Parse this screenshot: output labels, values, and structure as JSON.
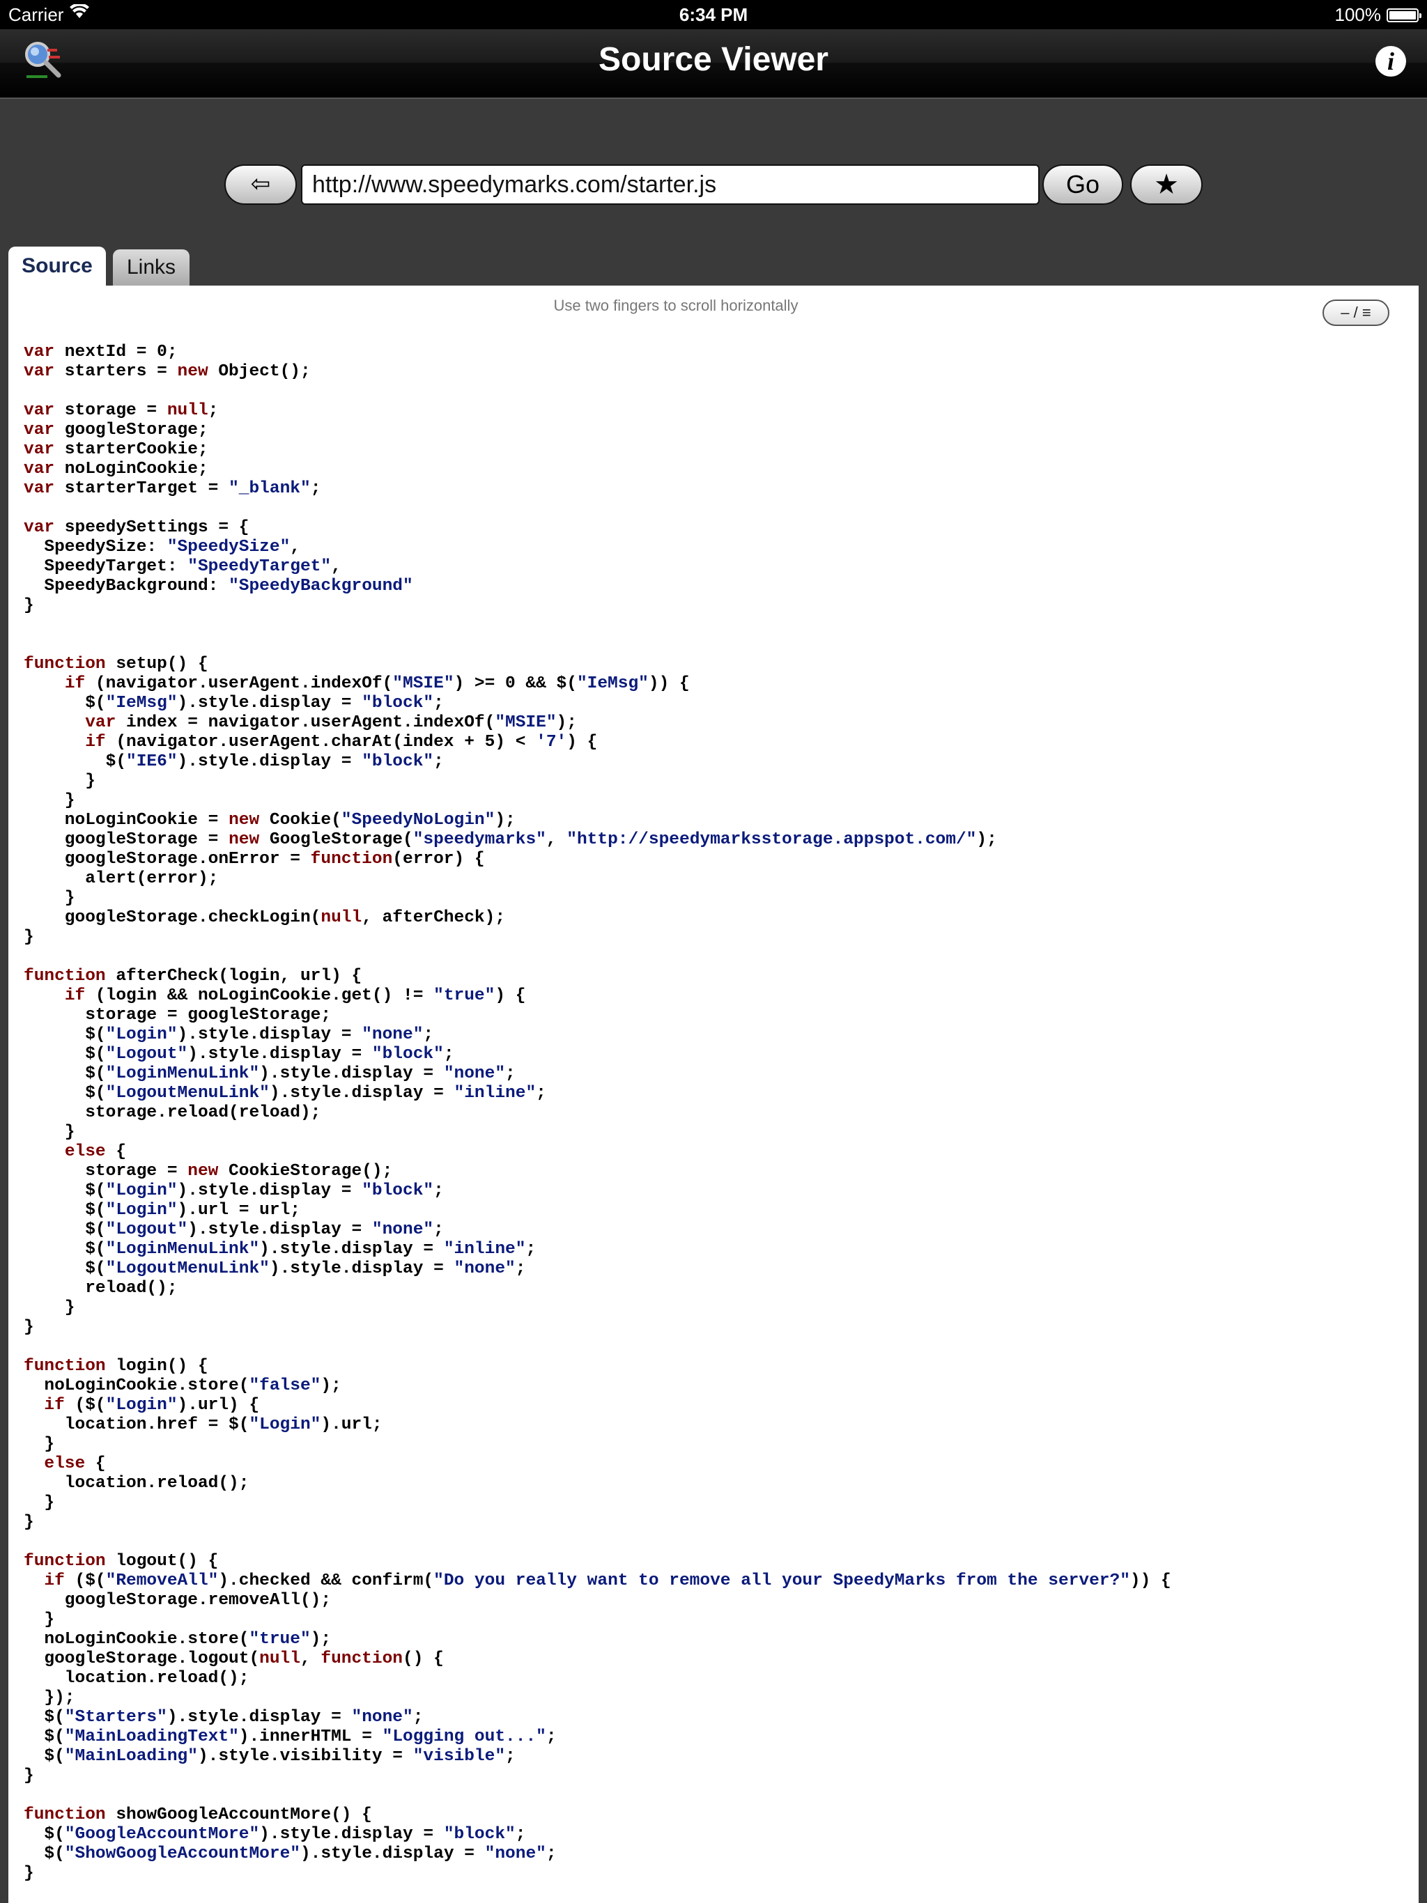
{
  "status_bar": {
    "carrier": "Carrier",
    "time": "6:34 PM",
    "battery": "100%"
  },
  "navbar": {
    "title": "Source Viewer",
    "info_label": "i"
  },
  "toolbar": {
    "back_label": "⇦",
    "url": "http://www.speedymarks.com/starter.js",
    "go_label": "Go",
    "favorite_label": "★"
  },
  "tabs": [
    {
      "label": "Source",
      "active": true
    },
    {
      "label": "Links",
      "active": false
    }
  ],
  "content": {
    "hint": "Use two fingers to scroll horizontally",
    "toggle_label": "– / ≡"
  },
  "code_lines": [
    "var nextId = 0;",
    "var starters = new Object();",
    "",
    "var storage = null;",
    "var googleStorage;",
    "var starterCookie;",
    "var noLoginCookie;",
    "var starterTarget = \"_blank\";",
    "",
    "var speedySettings = {",
    "  SpeedySize: \"SpeedySize\",",
    "  SpeedyTarget: \"SpeedyTarget\",",
    "  SpeedyBackground: \"SpeedyBackground\"",
    "}",
    "",
    "",
    "function setup() {",
    "    if (navigator.userAgent.indexOf(\"MSIE\") >= 0 && $(\"IeMsg\")) {",
    "      $(\"IeMsg\").style.display = \"block\";",
    "      var index = navigator.userAgent.indexOf(\"MSIE\");",
    "      if (navigator.userAgent.charAt(index + 5) < '7') {",
    "        $(\"IE6\").style.display = \"block\";",
    "      }",
    "    }",
    "    noLoginCookie = new Cookie(\"SpeedyNoLogin\");",
    "    googleStorage = new GoogleStorage(\"speedymarks\", \"http://speedymarksstorage.appspot.com/\");",
    "    googleStorage.onError = function(error) {",
    "      alert(error);",
    "    }",
    "    googleStorage.checkLogin(null, afterCheck);",
    "}",
    "",
    "function afterCheck(login, url) {",
    "    if (login && noLoginCookie.get() != \"true\") {",
    "      storage = googleStorage;",
    "      $(\"Login\").style.display = \"none\";",
    "      $(\"Logout\").style.display = \"block\";",
    "      $(\"LoginMenuLink\").style.display = \"none\";",
    "      $(\"LogoutMenuLink\").style.display = \"inline\";",
    "      storage.reload(reload);",
    "    }",
    "    else {",
    "      storage = new CookieStorage();",
    "      $(\"Login\").style.display = \"block\";",
    "      $(\"Login\").url = url;",
    "      $(\"Logout\").style.display = \"none\";",
    "      $(\"LoginMenuLink\").style.display = \"inline\";",
    "      $(\"LogoutMenuLink\").style.display = \"none\";",
    "      reload();",
    "    }",
    "}",
    "",
    "function login() {",
    "  noLoginCookie.store(\"false\");",
    "  if ($(\"Login\").url) {",
    "    location.href = $(\"Login\").url;",
    "  }",
    "  else {",
    "    location.reload();",
    "  }",
    "}",
    "",
    "function logout() {",
    "  if ($(\"RemoveAll\").checked && confirm(\"Do you really want to remove all your SpeedyMarks from the server?\")) {",
    "    googleStorage.removeAll();",
    "  }",
    "  noLoginCookie.store(\"true\");",
    "  googleStorage.logout(null, function() {",
    "    location.reload();",
    "  });",
    "  $(\"Starters\").style.display = \"none\";",
    "  $(\"MainLoadingText\").innerHTML = \"Logging out...\";",
    "  $(\"MainLoading\").style.visibility = \"visible\";",
    "}",
    "",
    "function showGoogleAccountMore() {",
    "  $(\"GoogleAccountMore\").style.display = \"block\";",
    "  $(\"ShowGoogleAccountMore\").style.display = \"none\";",
    "}"
  ]
}
